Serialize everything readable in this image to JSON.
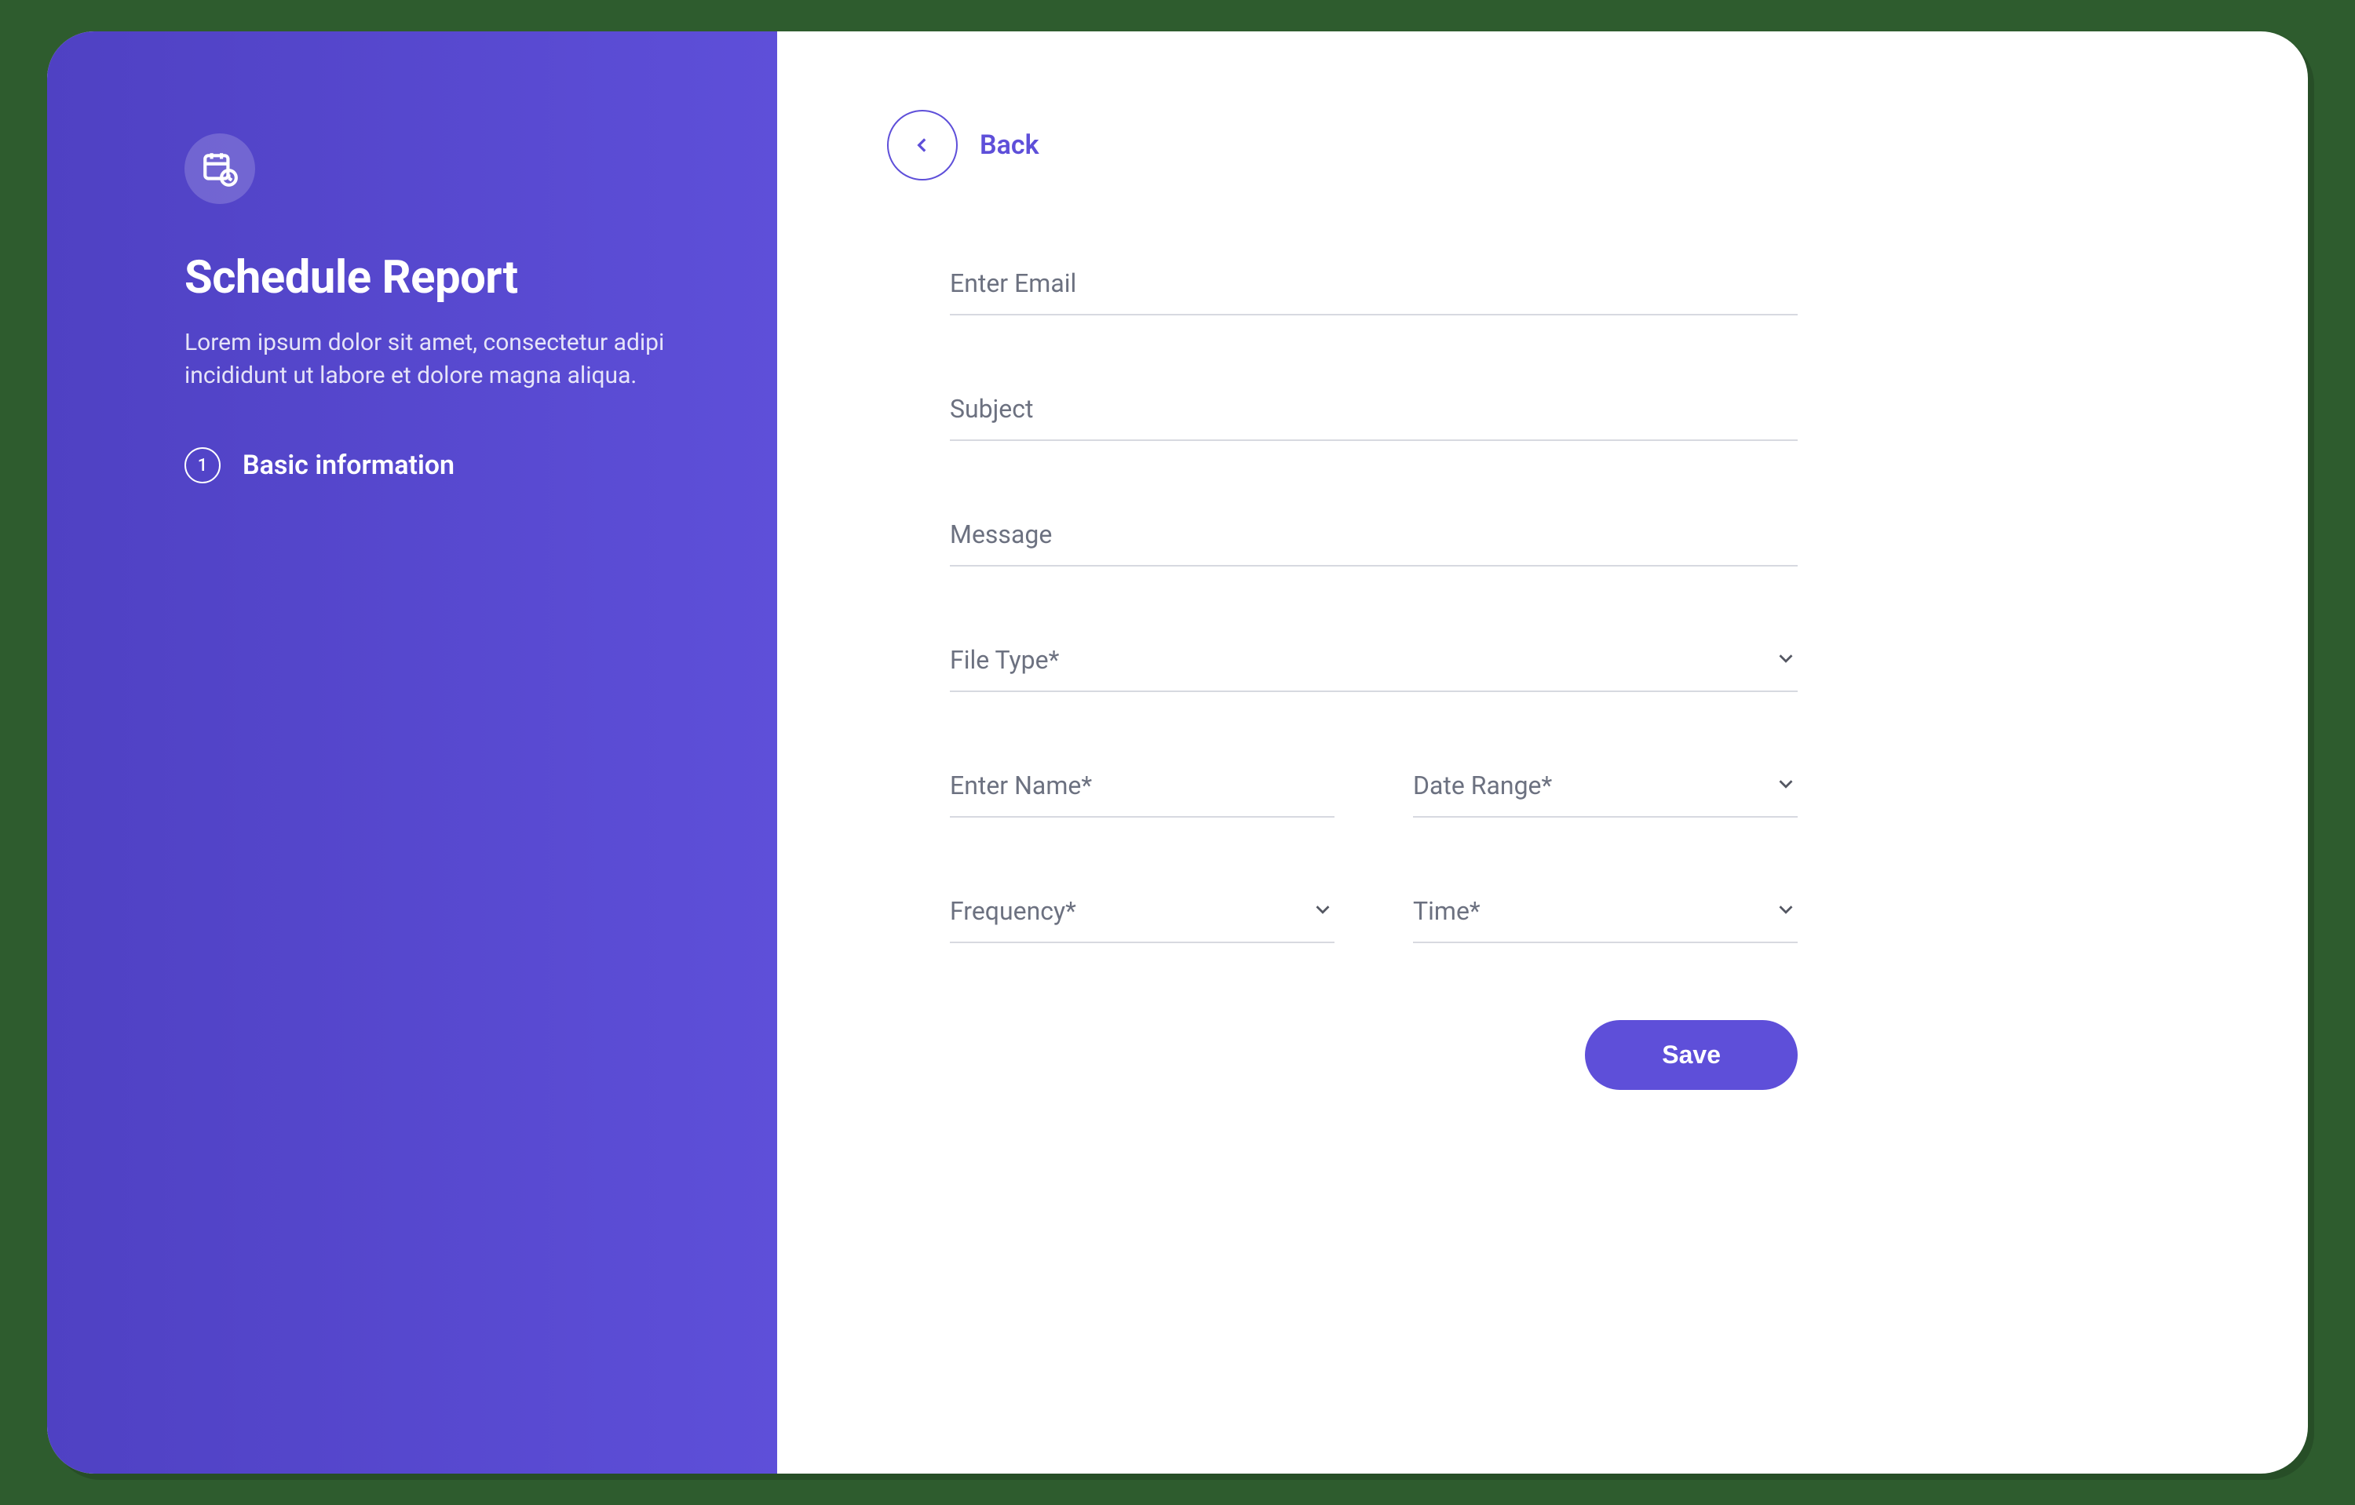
{
  "sidebar": {
    "title": "Schedule Report",
    "description": "Lorem ipsum dolor sit amet, consectetur adipi incididunt ut labore et dolore magna aliqua.",
    "steps": [
      {
        "number": "1",
        "label": "Basic information"
      }
    ]
  },
  "header": {
    "back_label": "Back"
  },
  "form": {
    "email_placeholder": "Enter Email",
    "subject_placeholder": "Subject",
    "message_placeholder": "Message",
    "file_type_placeholder": "File Type*",
    "name_placeholder": "Enter Name*",
    "date_range_placeholder": "Date Range*",
    "frequency_placeholder": "Frequency*",
    "time_placeholder": "Time*",
    "save_label": "Save"
  },
  "colors": {
    "primary": "#5e4fd9",
    "text_muted": "#6c7180",
    "border": "#d7d9e0"
  }
}
